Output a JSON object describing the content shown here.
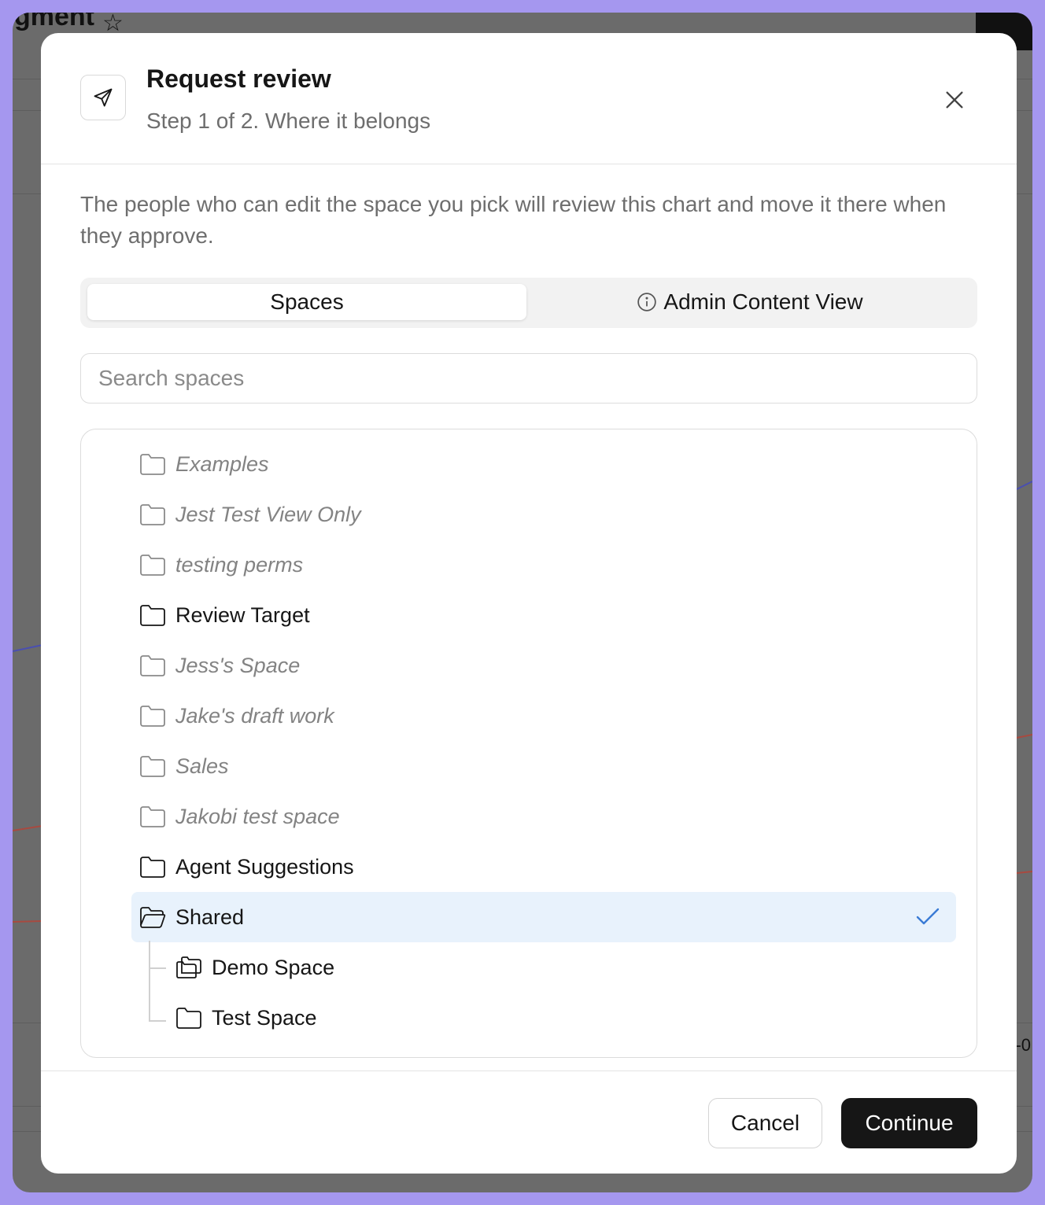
{
  "background": {
    "title_fragment": "gment",
    "axis_label": "-0"
  },
  "modal": {
    "title": "Request review",
    "subtitle": "Step 1 of 2. Where it belongs",
    "description": "The people who can edit the space you pick will review this chart and move it there when they approve.",
    "tabs": [
      {
        "label": "Spaces",
        "active": true
      },
      {
        "label": "Admin Content View",
        "icon": "info-icon",
        "active": false
      }
    ],
    "search": {
      "placeholder": "Search spaces",
      "value": ""
    },
    "spaces": [
      {
        "label": "Examples",
        "state": "disabled",
        "icon": "folder-icon"
      },
      {
        "label": "Jest Test View Only",
        "state": "disabled",
        "icon": "folder-icon"
      },
      {
        "label": "testing perms",
        "state": "disabled",
        "icon": "folder-icon"
      },
      {
        "label": "Review Target",
        "state": "enabled",
        "icon": "folder-icon"
      },
      {
        "label": "Jess's Space",
        "state": "disabled",
        "icon": "folder-icon"
      },
      {
        "label": "Jake's draft work",
        "state": "disabled",
        "icon": "folder-icon"
      },
      {
        "label": "Sales",
        "state": "disabled",
        "icon": "folder-icon"
      },
      {
        "label": "Jakobi test space",
        "state": "disabled",
        "icon": "folder-icon"
      },
      {
        "label": "Agent Suggestions",
        "state": "enabled",
        "icon": "folder-icon"
      },
      {
        "label": "Shared",
        "state": "selected",
        "icon": "folder-open-icon",
        "children": [
          {
            "label": "Demo Space",
            "icon": "folders-stack-icon"
          },
          {
            "label": "Test Space",
            "icon": "folder-icon"
          }
        ]
      }
    ],
    "footer": {
      "cancel_label": "Cancel",
      "continue_label": "Continue"
    },
    "colors": {
      "accent": "#3a7bd5",
      "selected_bg": "#e8f2fc",
      "primary_button": "#161616"
    }
  }
}
